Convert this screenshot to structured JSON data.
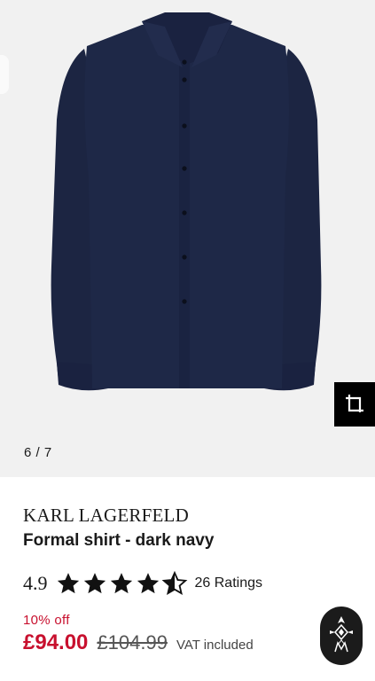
{
  "gallery": {
    "counter": "6 / 7",
    "image_subject": "Formal shirt - dark navy"
  },
  "product": {
    "brand": "KARL LAGERFELD",
    "title": "Formal shirt - dark navy",
    "rating": "4.9",
    "rating_fraction": 0.9,
    "rating_count": "26 Ratings",
    "discount": "10% off",
    "price": "£94.00",
    "original_price": "£104.99",
    "vat": "VAT included"
  },
  "colors": {
    "price_red": "#c8102e",
    "shirt_navy": "#1d2744",
    "gallery_bg": "#f1f1f1",
    "button_black": "#000000"
  },
  "icons": {
    "ar": "ar-view-icon",
    "assistant": "assistant-logo-icon",
    "star": "star-icon"
  }
}
